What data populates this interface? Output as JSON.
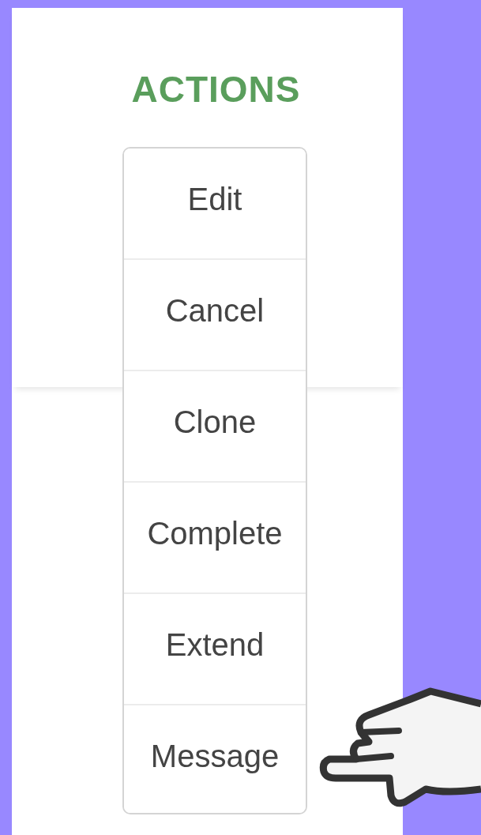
{
  "header": {
    "title": "ACTIONS"
  },
  "menu": {
    "items": [
      {
        "label": "Edit"
      },
      {
        "label": "Cancel"
      },
      {
        "label": "Clone"
      },
      {
        "label": "Complete"
      },
      {
        "label": "Extend"
      },
      {
        "label": "Message"
      }
    ]
  }
}
